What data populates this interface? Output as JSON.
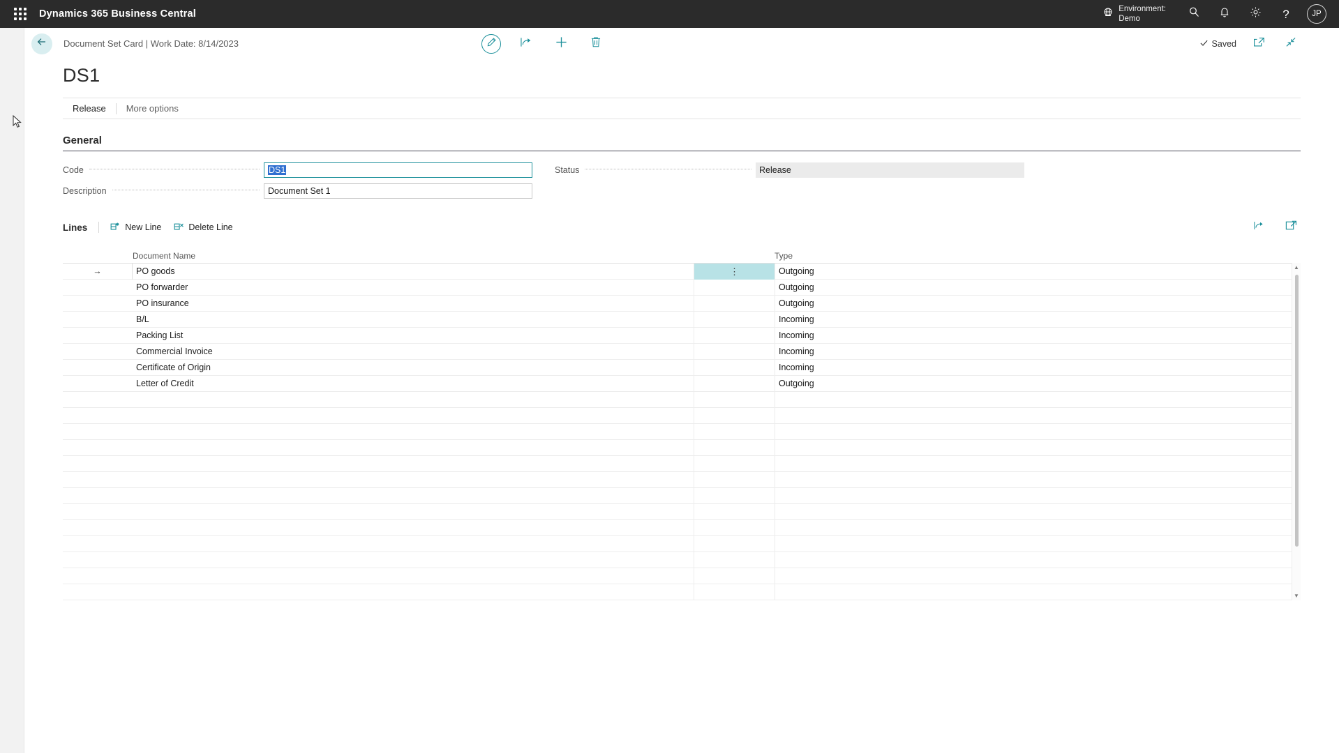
{
  "appbar": {
    "waffle_icon": "waffle-grid-icon",
    "title": "Dynamics 365 Business Central",
    "environment_label": "Environment:",
    "environment_name": "Demo",
    "globe_icon": "globe-icon",
    "search_icon": "search-icon",
    "notification_icon": "bell-icon",
    "settings_icon": "gear-icon",
    "help_icon": "question-mark-icon",
    "avatar_initials": "JP"
  },
  "commandbar": {
    "back_icon": "back-arrow-icon",
    "breadcrumb": "Document Set Card | Work Date: 8/14/2023",
    "edit_icon": "pencil-icon",
    "share_icon": "share-icon",
    "new_icon": "plus-icon",
    "delete_icon": "trash-icon",
    "saved_label": "Saved",
    "saved_check_icon": "checkmark-icon",
    "open_new_window_icon": "open-in-new-window-icon",
    "collapse_icon": "collapse-icon"
  },
  "page": {
    "title": "DS1",
    "tabs": [
      {
        "label": "Release",
        "active": true
      },
      {
        "label": "More options",
        "active": false
      }
    ]
  },
  "general": {
    "section_title": "General",
    "fields_left": [
      {
        "label": "Code",
        "value": "DS1",
        "selected": true,
        "readonly": false
      },
      {
        "label": "Description",
        "value": "Document Set 1",
        "selected": false,
        "readonly": false
      }
    ],
    "fields_right": [
      {
        "label": "Status",
        "value": "Release",
        "readonly": true
      }
    ]
  },
  "lines": {
    "title": "Lines",
    "new_line_label": "New Line",
    "new_line_icon": "new-row-icon",
    "delete_line_label": "Delete Line",
    "delete_line_icon": "delete-row-icon",
    "share_icon": "share-icon",
    "open_excel_icon": "open-in-excel-icon",
    "columns": [
      "",
      "Document Name",
      "",
      "Type"
    ],
    "rows": [
      {
        "indicator": "→",
        "document_name": "PO goods",
        "type": "Outgoing",
        "current": true,
        "menu_icon": "vertical-ellipsis-icon"
      },
      {
        "indicator": "",
        "document_name": "PO forwarder",
        "type": "Outgoing",
        "current": false
      },
      {
        "indicator": "",
        "document_name": "PO insurance",
        "type": "Outgoing",
        "current": false
      },
      {
        "indicator": "",
        "document_name": "B/L",
        "type": "Incoming",
        "current": false
      },
      {
        "indicator": "",
        "document_name": "Packing List",
        "type": "Incoming",
        "current": false
      },
      {
        "indicator": "",
        "document_name": "Commercial Invoice",
        "type": "Incoming",
        "current": false
      },
      {
        "indicator": "",
        "document_name": "Certificate of Origin",
        "type": "Incoming",
        "current": false
      },
      {
        "indicator": "",
        "document_name": "Letter of Credit",
        "type": "Outgoing",
        "current": false
      }
    ],
    "empty_row_count": 13,
    "scroll_up_icon": "scroll-up-arrow-icon",
    "scroll_down_icon": "scroll-down-arrow-icon"
  },
  "colors": {
    "accent_teal": "#1a8f9a",
    "appbar_bg": "#2b2b2b",
    "selection_blue": "#2f6fd0",
    "cell_highlight": "#b8e2e6",
    "back_circle": "#d9eef0"
  }
}
